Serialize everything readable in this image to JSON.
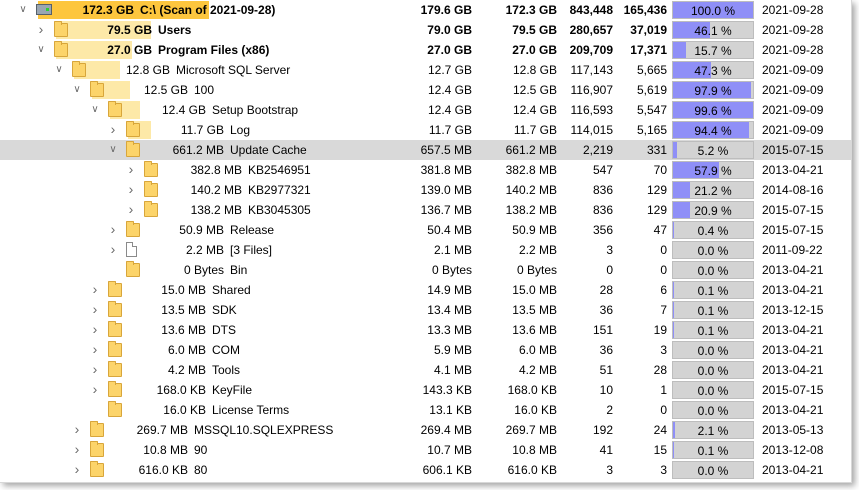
{
  "rows": [
    {
      "level": 0,
      "expander": "open",
      "icon": "drive",
      "bar": 0.45,
      "size": "172.3 GB",
      "name": "C:\\  (Scan of 2021-09-28)",
      "allocated": "179.6 GB",
      "size2": "172.3 GB",
      "files": "843,448",
      "folders": "165,436",
      "percent": "100.0 %",
      "percent_value": 100.0,
      "date": "2021-09-28",
      "bold": true,
      "root": true
    },
    {
      "level": 1,
      "expander": "closed",
      "icon": "folder",
      "bar": 0.25,
      "size": "79.5 GB",
      "name": "Users",
      "allocated": "79.0 GB",
      "size2": "79.5 GB",
      "files": "280,657",
      "folders": "37,019",
      "percent": "46.1 %",
      "percent_value": 46.1,
      "date": "2021-09-28",
      "bold": true
    },
    {
      "level": 1,
      "expander": "open",
      "icon": "folder",
      "bar": 0.2,
      "size": "27.0 GB",
      "name": "Program Files (x86)",
      "allocated": "27.0 GB",
      "size2": "27.0 GB",
      "files": "209,709",
      "folders": "17,371",
      "percent": "15.7 %",
      "percent_value": 15.7,
      "date": "2021-09-28",
      "bold": true
    },
    {
      "level": 2,
      "expander": "open",
      "icon": "folder",
      "bar": 0.12,
      "size": "12.8 GB",
      "name": "Microsoft SQL Server",
      "allocated": "12.7 GB",
      "size2": "12.8 GB",
      "files": "117,143",
      "folders": "5,665",
      "percent": "47.3 %",
      "percent_value": 47.3,
      "date": "2021-09-09"
    },
    {
      "level": 3,
      "expander": "open",
      "icon": "folder",
      "bar": 0.1,
      "size": "12.5 GB",
      "name": "100",
      "allocated": "12.4 GB",
      "size2": "12.5 GB",
      "files": "116,907",
      "folders": "5,619",
      "percent": "97.9 %",
      "percent_value": 97.9,
      "date": "2021-09-09"
    },
    {
      "level": 4,
      "expander": "open",
      "icon": "folder",
      "bar": 0.08,
      "size": "12.4 GB",
      "name": "Setup Bootstrap",
      "allocated": "12.4 GB",
      "size2": "12.4 GB",
      "files": "116,593",
      "folders": "5,547",
      "percent": "99.6 %",
      "percent_value": 99.6,
      "date": "2021-09-09"
    },
    {
      "level": 5,
      "expander": "closed",
      "icon": "folder",
      "bar": 0.06,
      "size": "11.7 GB",
      "name": "Log",
      "allocated": "11.7 GB",
      "size2": "11.7 GB",
      "files": "114,015",
      "folders": "5,165",
      "percent": "94.4 %",
      "percent_value": 94.4,
      "date": "2021-09-09"
    },
    {
      "level": 5,
      "expander": "open",
      "icon": "folder",
      "bar": 0.0,
      "size": "661.2 MB",
      "name": "Update Cache",
      "allocated": "657.5 MB",
      "size2": "661.2 MB",
      "files": "2,219",
      "folders": "331",
      "percent": "5.2 %",
      "percent_value": 5.2,
      "date": "2015-07-15",
      "selected": true
    },
    {
      "level": 6,
      "expander": "closed",
      "icon": "folder",
      "bar": 0.0,
      "size": "382.8 MB",
      "name": "KB2546951",
      "allocated": "381.8 MB",
      "size2": "382.8 MB",
      "files": "547",
      "folders": "70",
      "percent": "57.9 %",
      "percent_value": 57.9,
      "date": "2013-04-21"
    },
    {
      "level": 6,
      "expander": "closed",
      "icon": "folder",
      "bar": 0.0,
      "size": "140.2 MB",
      "name": "KB2977321",
      "allocated": "139.0 MB",
      "size2": "140.2 MB",
      "files": "836",
      "folders": "129",
      "percent": "21.2 %",
      "percent_value": 21.2,
      "date": "2014-08-16"
    },
    {
      "level": 6,
      "expander": "closed",
      "icon": "folder",
      "bar": 0.0,
      "size": "138.2 MB",
      "name": "KB3045305",
      "allocated": "136.7 MB",
      "size2": "138.2 MB",
      "files": "836",
      "folders": "129",
      "percent": "20.9 %",
      "percent_value": 20.9,
      "date": "2015-07-15"
    },
    {
      "level": 5,
      "expander": "closed",
      "icon": "folder",
      "bar": 0.0,
      "size": "50.9 MB",
      "name": "Release",
      "allocated": "50.4 MB",
      "size2": "50.9 MB",
      "files": "356",
      "folders": "47",
      "percent": "0.4 %",
      "percent_value": 0.4,
      "date": "2015-07-15"
    },
    {
      "level": 5,
      "expander": "closed",
      "icon": "file",
      "bar": 0.0,
      "size": "2.2 MB",
      "name": "[3 Files]",
      "allocated": "2.1 MB",
      "size2": "2.2 MB",
      "files": "3",
      "folders": "0",
      "percent": "0.0 %",
      "percent_value": 0.0,
      "date": "2011-09-22"
    },
    {
      "level": 5,
      "expander": "none",
      "icon": "folder",
      "bar": 0.0,
      "size": "0 Bytes",
      "name": "Bin",
      "allocated": "0 Bytes",
      "size2": "0 Bytes",
      "files": "0",
      "folders": "0",
      "percent": "0.0 %",
      "percent_value": 0.0,
      "date": "2013-04-21"
    },
    {
      "level": 4,
      "expander": "closed",
      "icon": "folder",
      "bar": 0.0,
      "size": "15.0 MB",
      "name": "Shared",
      "allocated": "14.9 MB",
      "size2": "15.0 MB",
      "files": "28",
      "folders": "6",
      "percent": "0.1 %",
      "percent_value": 0.1,
      "date": "2013-04-21"
    },
    {
      "level": 4,
      "expander": "closed",
      "icon": "folder",
      "bar": 0.0,
      "size": "13.5 MB",
      "name": "SDK",
      "allocated": "13.4 MB",
      "size2": "13.5 MB",
      "files": "36",
      "folders": "7",
      "percent": "0.1 %",
      "percent_value": 0.1,
      "date": "2013-12-15"
    },
    {
      "level": 4,
      "expander": "closed",
      "icon": "folder",
      "bar": 0.0,
      "size": "13.6 MB",
      "name": "DTS",
      "allocated": "13.3 MB",
      "size2": "13.6 MB",
      "files": "151",
      "folders": "19",
      "percent": "0.1 %",
      "percent_value": 0.1,
      "date": "2013-04-21"
    },
    {
      "level": 4,
      "expander": "closed",
      "icon": "folder",
      "bar": 0.0,
      "size": "6.0 MB",
      "name": "COM",
      "allocated": "5.9 MB",
      "size2": "6.0 MB",
      "files": "36",
      "folders": "3",
      "percent": "0.0 %",
      "percent_value": 0.0,
      "date": "2013-04-21"
    },
    {
      "level": 4,
      "expander": "closed",
      "icon": "folder",
      "bar": 0.0,
      "size": "4.2 MB",
      "name": "Tools",
      "allocated": "4.1 MB",
      "size2": "4.2 MB",
      "files": "51",
      "folders": "28",
      "percent": "0.0 %",
      "percent_value": 0.0,
      "date": "2013-04-21"
    },
    {
      "level": 4,
      "expander": "closed",
      "icon": "folder",
      "bar": 0.0,
      "size": "168.0 KB",
      "name": "KeyFile",
      "allocated": "143.3 KB",
      "size2": "168.0 KB",
      "files": "10",
      "folders": "1",
      "percent": "0.0 %",
      "percent_value": 0.0,
      "date": "2015-07-15"
    },
    {
      "level": 4,
      "expander": "none",
      "icon": "folder",
      "bar": 0.0,
      "size": "16.0 KB",
      "name": "License Terms",
      "allocated": "13.1 KB",
      "size2": "16.0 KB",
      "files": "2",
      "folders": "0",
      "percent": "0.0 %",
      "percent_value": 0.0,
      "date": "2013-04-21"
    },
    {
      "level": 3,
      "expander": "closed",
      "icon": "folder",
      "bar": 0.0,
      "size": "269.7 MB",
      "name": "MSSQL10.SQLEXPRESS",
      "allocated": "269.4 MB",
      "size2": "269.7 MB",
      "files": "192",
      "folders": "24",
      "percent": "2.1 %",
      "percent_value": 2.1,
      "date": "2013-05-13"
    },
    {
      "level": 3,
      "expander": "closed",
      "icon": "folder",
      "bar": 0.0,
      "size": "10.8 MB",
      "name": "90",
      "allocated": "10.7 MB",
      "size2": "10.8 MB",
      "files": "41",
      "folders": "15",
      "percent": "0.1 %",
      "percent_value": 0.1,
      "date": "2013-12-08"
    },
    {
      "level": 3,
      "expander": "closed",
      "icon": "folder",
      "bar": 0.0,
      "size": "616.0 KB",
      "name": "80",
      "allocated": "606.1 KB",
      "size2": "616.0 KB",
      "files": "3",
      "folders": "3",
      "percent": "0.0 %",
      "percent_value": 0.0,
      "date": "2013-04-21"
    }
  ]
}
